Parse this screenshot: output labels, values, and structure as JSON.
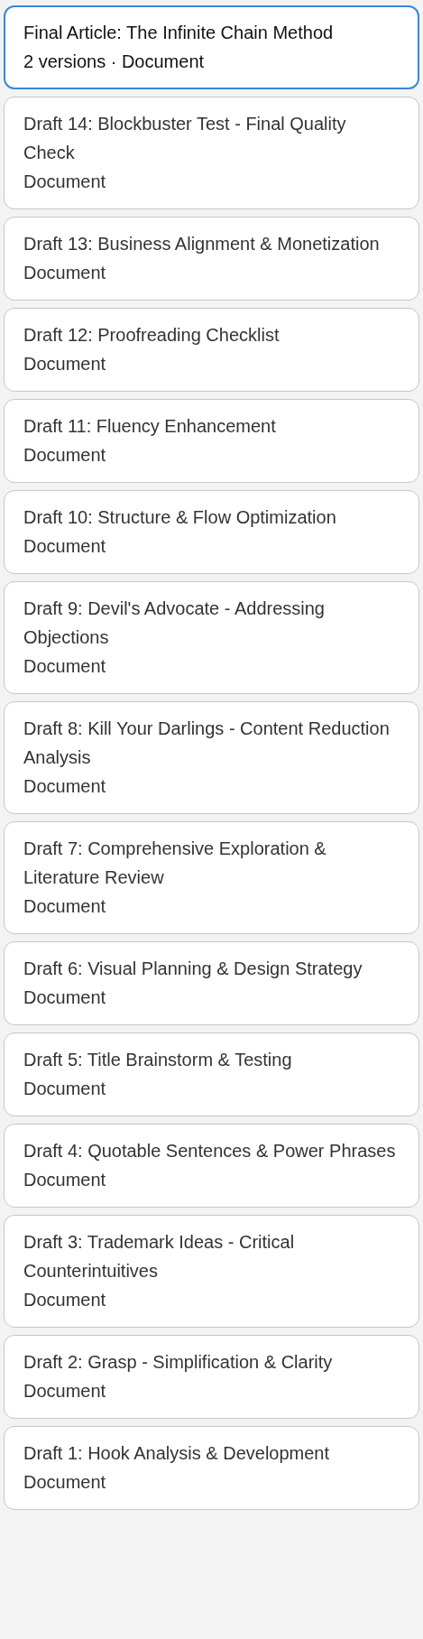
{
  "items": [
    {
      "title": "Final Article: The Infinite Chain Method",
      "meta": "2 versions · Document",
      "selected": true
    },
    {
      "title": "Draft 14: Blockbuster Test - Final Quality Check",
      "meta": "Document",
      "selected": false
    },
    {
      "title": "Draft 13: Business Alignment & Monetization",
      "meta": "Document",
      "selected": false
    },
    {
      "title": "Draft 12: Proofreading Checklist",
      "meta": "Document",
      "selected": false
    },
    {
      "title": "Draft 11: Fluency Enhancement",
      "meta": "Document",
      "selected": false
    },
    {
      "title": "Draft 10: Structure & Flow Optimization",
      "meta": "Document",
      "selected": false
    },
    {
      "title": "Draft 9: Devil's Advocate - Addressing Objections",
      "meta": "Document",
      "selected": false
    },
    {
      "title": "Draft 8: Kill Your Darlings - Content Reduction Analysis",
      "meta": "Document",
      "selected": false
    },
    {
      "title": "Draft 7: Comprehensive Exploration & Literature Review",
      "meta": "Document",
      "selected": false
    },
    {
      "title": "Draft 6: Visual Planning & Design Strategy",
      "meta": "Document",
      "selected": false
    },
    {
      "title": "Draft 5: Title Brainstorm & Testing",
      "meta": "Document",
      "selected": false
    },
    {
      "title": "Draft 4: Quotable Sentences & Power Phrases",
      "meta": "Document",
      "selected": false
    },
    {
      "title": "Draft 3: Trademark Ideas - Critical Counterintuitives",
      "meta": "Document",
      "selected": false
    },
    {
      "title": "Draft 2: Grasp - Simplification & Clarity",
      "meta": "Document",
      "selected": false
    },
    {
      "title": "Draft 1: Hook Analysis & Development",
      "meta": "Document",
      "selected": false
    }
  ]
}
